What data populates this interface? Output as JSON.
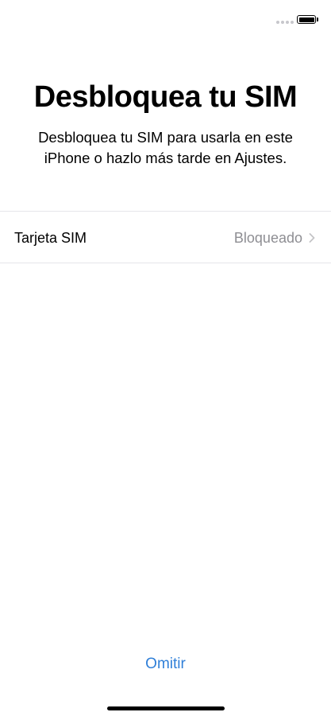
{
  "status_bar": {
    "battery": 1.0
  },
  "header": {
    "title": "Desbloquea tu SIM",
    "subtitle": "Desbloquea tu SIM para usarla en este iPhone o hazlo más tarde en Ajustes."
  },
  "sim_row": {
    "label": "Tarjeta SIM",
    "value": "Bloqueado",
    "icon": "chevron-right-icon"
  },
  "footer": {
    "skip_label": "Omitir"
  },
  "colors": {
    "accent": "#2f7fd8",
    "secondary_text": "#8e8e93",
    "separator": "#e5e5ea"
  }
}
